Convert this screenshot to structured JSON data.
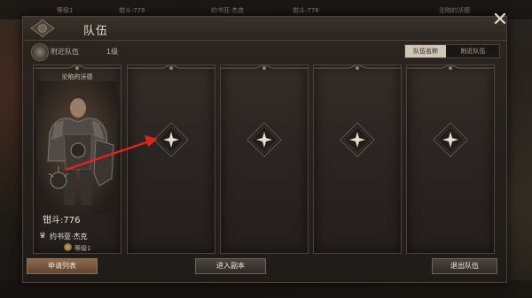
{
  "background_hud": {
    "top_left": "等级1",
    "top_gear": "钳斗:776",
    "top_name": "约书亚·杰克",
    "top_gear_2": "钳斗:776",
    "top_right": "沦陷的沃德"
  },
  "window": {
    "title": "队伍",
    "close_label": "✕"
  },
  "subheader": {
    "label": "附近队伍",
    "level": "1级",
    "tabs": [
      "队伍名称",
      "附近队伍"
    ]
  },
  "members": [
    {
      "top_label": "沦陷的沃德",
      "gear_score": "钳斗:776",
      "name": "约书亚·杰克",
      "level": "等级1"
    }
  ],
  "empty_slot_count": 4,
  "buttons": {
    "apply_list": "申请列表",
    "enter_dungeon": "进入副本",
    "leave_team": "退出队伍"
  },
  "colors": {
    "accent_red": "#e0231b",
    "panel_bg": "#2b2622",
    "tab_active": "#cfc6b6"
  }
}
